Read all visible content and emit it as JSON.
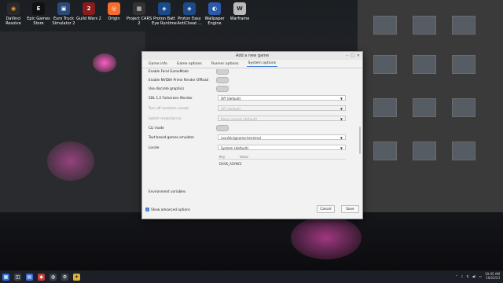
{
  "desktop_icons": [
    {
      "label": "DaVinci Resolve",
      "color": "#2a2a2a",
      "glyph": "◉"
    },
    {
      "label": "Epic Games Store",
      "color": "#111111",
      "glyph": "E"
    },
    {
      "label": "Euro Truck Simulator 2",
      "color": "#2b4a7a",
      "glyph": "▣"
    },
    {
      "label": "Guild Wars 2",
      "color": "#8a1c1c",
      "glyph": "2"
    },
    {
      "label": "Origin",
      "color": "#f56c2d",
      "glyph": "◎"
    },
    {
      "label": "Project CARS 2",
      "color": "#333333",
      "glyph": "▦"
    },
    {
      "label": "Proton Batt Eye Runtime",
      "color": "#1a4a8a",
      "glyph": "◈"
    },
    {
      "label": "Proton Easy AntiCheat ...",
      "color": "#1a4a8a",
      "glyph": "◈"
    },
    {
      "label": "Wallpaper Engine",
      "color": "#2a5aa8",
      "glyph": "◐"
    },
    {
      "label": "Warframe",
      "color": "#bbbbbb",
      "glyph": "W"
    }
  ],
  "dialog": {
    "title": "Add a new game",
    "tabs": [
      "Game info",
      "Game options",
      "Runner options",
      "System options"
    ],
    "active_tab": "System options",
    "rows": {
      "gamemode": "Enable Feral GameMode",
      "prime": "Enable NVIDIA Prime Render Offload",
      "discrete": "Use discrete graphics",
      "sdl_label": "SDL 1.2 Fullscreen Monitor",
      "sdl_value": "Off (default)",
      "monitors_label": "Turn off monitors except",
      "monitors_value": "Off (default)",
      "resolution_label": "Switch resolution to",
      "resolution_value": "Keep current (default)",
      "cli_label": "CLI mode",
      "terminal_label": "Text based games emulator",
      "terminal_value": "/usr/bin/gnome-terminal",
      "locale_label": "Locale",
      "locale_value": "System (default)",
      "env_key_header": "Key",
      "env_value_header": "Value",
      "env_key": "DXVK_ASYNC",
      "env_value": "1",
      "env_label": "Environment variables"
    },
    "footer": {
      "advanced": "Show advanced options",
      "cancel": "Cancel",
      "save": "Save"
    }
  },
  "taskbar": {
    "time": "10:45 AM",
    "date": "10/23/23"
  }
}
